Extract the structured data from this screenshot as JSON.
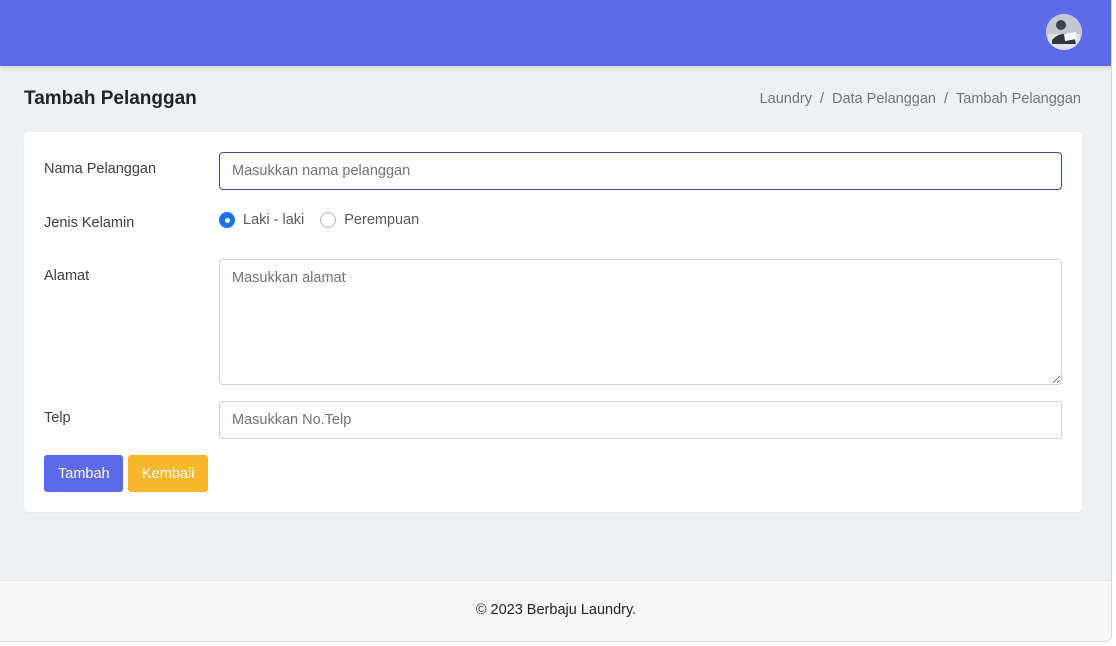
{
  "header": {
    "avatar_icon": "user-avatar",
    "brand_color": "#5c6ae7"
  },
  "page": {
    "title": "Tambah Pelanggan"
  },
  "breadcrumb": {
    "items": [
      "Laundry",
      "Data Pelanggan",
      "Tambah Pelanggan"
    ],
    "separator": "/"
  },
  "form": {
    "nama": {
      "label": "Nama Pelanggan",
      "placeholder": "Masukkan nama pelanggan",
      "value": ""
    },
    "jenis_kelamin": {
      "label": "Jenis Kelamin",
      "options": [
        "Laki - laki",
        "Perempuan"
      ],
      "selected": "Laki - laki"
    },
    "alamat": {
      "label": "Alamat",
      "placeholder": "Masukkan alamat",
      "value": ""
    },
    "telp": {
      "label": "Telp",
      "placeholder": "Masukkan No.Telp",
      "value": ""
    },
    "submit_label": "Tambah",
    "back_label": "Kembali",
    "submit_color": "#5c6ae7",
    "back_color": "#f6b72c"
  },
  "footer": {
    "text": "© 2023 Berbaju Laundry."
  }
}
